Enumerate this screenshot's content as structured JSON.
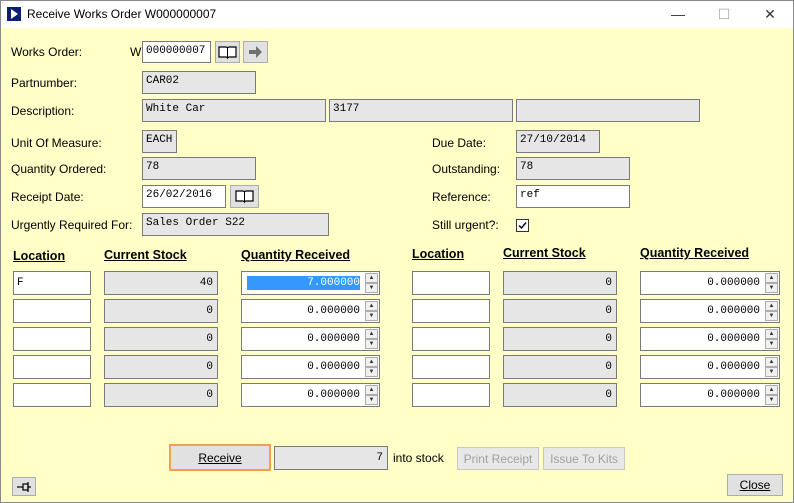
{
  "window": {
    "title": "Receive Works Order W000000007",
    "minimize": "—",
    "maximize": "☐",
    "close": "✕"
  },
  "header": {
    "works_order_label": "Works Order:",
    "works_order_prefix": "W",
    "works_order_value": "000000007",
    "partnumber_label": "Partnumber:",
    "partnumber_value": "CAR02",
    "description_label": "Description:",
    "description_1": "White Car",
    "description_2": "3177",
    "description_3": "",
    "uom_label": "Unit Of Measure:",
    "uom_value": "EACH",
    "qty_ordered_label": "Quantity Ordered:",
    "qty_ordered_value": "78",
    "receipt_date_label": "Receipt Date:",
    "receipt_date_value": "26/02/2016",
    "urgent_for_label": "Urgently Required For:",
    "urgent_for_value": "Sales Order S22",
    "due_date_label": "Due Date:",
    "due_date_value": "27/10/2014",
    "outstanding_label": "Outstanding:",
    "outstanding_value": "78",
    "reference_label": "Reference:",
    "reference_value": "ref",
    "still_urgent_label": "Still urgent?:",
    "still_urgent_checked": true
  },
  "grid": {
    "headers": {
      "location": "Location",
      "current_stock": "Current Stock",
      "quantity_received": "Quantity Received"
    },
    "left_rows": [
      {
        "location": "F",
        "stock": "40",
        "qty": "7.000000"
      },
      {
        "location": "",
        "stock": "0",
        "qty": "0.000000"
      },
      {
        "location": "",
        "stock": "0",
        "qty": "0.000000"
      },
      {
        "location": "",
        "stock": "0",
        "qty": "0.000000"
      },
      {
        "location": "",
        "stock": "0",
        "qty": "0.000000"
      }
    ],
    "right_rows": [
      {
        "location": "",
        "stock": "0",
        "qty": "0.000000"
      },
      {
        "location": "",
        "stock": "0",
        "qty": "0.000000"
      },
      {
        "location": "",
        "stock": "0",
        "qty": "0.000000"
      },
      {
        "location": "",
        "stock": "0",
        "qty": "0.000000"
      },
      {
        "location": "",
        "stock": "0",
        "qty": "0.000000"
      }
    ]
  },
  "footer": {
    "receive_label": "Receive",
    "receive_total": "7",
    "into_stock_label": "into stock",
    "print_receipt_label": "Print Receipt",
    "issue_to_kits_label": "Issue To Kits",
    "close_label": "Close"
  },
  "icons": {
    "app": "play-arrow-icon",
    "lookup": "book-icon",
    "navigate": "arrow-right-icon",
    "pin": "pin-icon"
  }
}
